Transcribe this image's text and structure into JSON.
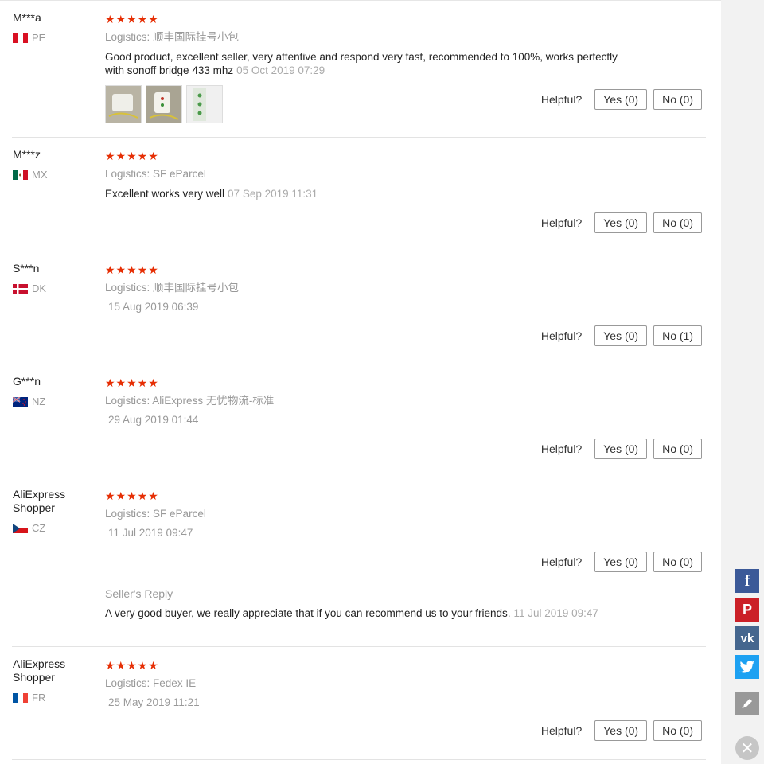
{
  "helpful_label": "Helpful?",
  "reviews": [
    {
      "name": "M***a",
      "country": "PE",
      "stars": "★★★★★",
      "logistics_label": "Logistics:",
      "logistics": "顺丰国际挂号小包",
      "comment": "Good product, excellent seller, very attentive and respond very fast, recommended to 100%, works perfectly with sonoff bridge 433 mhz",
      "date": "05 Oct 2019 07:29",
      "yes": "Yes (0)",
      "no": "No (0)"
    },
    {
      "name": "M***z",
      "country": "MX",
      "stars": "★★★★★",
      "logistics_label": "Logistics:",
      "logistics": "SF eParcel",
      "comment": "Excellent works very well",
      "date": "07 Sep 2019 11:31",
      "yes": "Yes (0)",
      "no": "No (0)"
    },
    {
      "name": "S***n",
      "country": "DK",
      "stars": "★★★★★",
      "logistics_label": "Logistics:",
      "logistics": "顺丰国际挂号小包",
      "date": "15 Aug 2019 06:39",
      "yes": "Yes (0)",
      "no": "No (1)"
    },
    {
      "name": "G***n",
      "country": "NZ",
      "stars": "★★★★★",
      "logistics_label": "Logistics:",
      "logistics": "AliExpress 无忧物流-标准",
      "date": "29 Aug 2019 01:44",
      "yes": "Yes (0)",
      "no": "No (0)"
    },
    {
      "name": "AliExpress Shopper",
      "country": "CZ",
      "stars": "★★★★★",
      "logistics_label": "Logistics:",
      "logistics": "SF eParcel",
      "date": "11 Jul 2019 09:47",
      "yes": "Yes (0)",
      "no": "No (0)",
      "reply_title": "Seller's Reply",
      "reply_text": "A very good buyer, we really appreciate that if you can recommend us to your friends.",
      "reply_date": "11 Jul 2019 09:47"
    },
    {
      "name": "AliExpress Shopper",
      "country": "FR",
      "stars": "★★★★★",
      "logistics_label": "Logistics:",
      "logistics": "Fedex IE",
      "date": "25 May 2019 11:21",
      "yes": "Yes (0)",
      "no": "No (0)"
    }
  ],
  "share": {
    "facebook_glyph": "f",
    "facebook_color": "#3b5998",
    "pinterest_glyph": "P",
    "pinterest_color": "#cb2027",
    "vk_glyph": "vk",
    "vk_color": "#45668e",
    "twitter_color": "#1da1f2",
    "edit_color": "#999999",
    "close_glyph": "✕"
  },
  "colors": {
    "accent_star": "#e62e04"
  }
}
